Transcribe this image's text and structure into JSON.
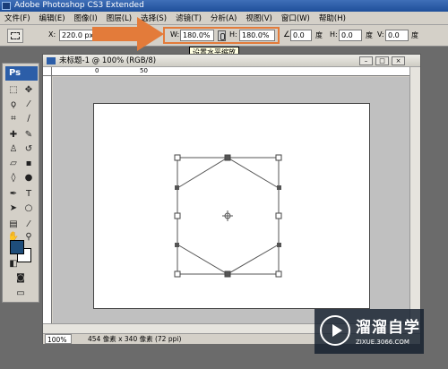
{
  "app": {
    "title": "Adobe Photoshop CS3 Extended"
  },
  "menu": [
    "文件(F)",
    "编辑(E)",
    "图像(I)",
    "图层(L)",
    "选择(S)",
    "滤镜(T)",
    "分析(A)",
    "视图(V)",
    "窗口(W)",
    "帮助(H)"
  ],
  "options": {
    "x_label": "X:",
    "x_value": "220.0 px",
    "w_label": "W:",
    "w_value": "180.0%",
    "h_label": "H:",
    "h_value": "180.0%",
    "rot_value": "0.0",
    "rot_unit": "度",
    "hskew_label": "H:",
    "hskew_value": "0.0",
    "hskew_unit": "度",
    "vskew_label": "V:",
    "vskew_value": "0.0",
    "vskew_unit": "度",
    "tooltip": "设置水平缩放"
  },
  "toolbox": {
    "logo": "Ps"
  },
  "document": {
    "title": "未标题-1 @ 100% (RGB/8)",
    "ruler_ticks": [
      "0",
      "50"
    ],
    "zoom": "100%",
    "status": "454 像素 x 340 像素 (72 ppi)"
  },
  "watermark": {
    "name": "溜溜自学",
    "url": "ZIXUE.3066.COM"
  },
  "colors": {
    "annotation": "#e37b3a",
    "foreground": "#1e4d7a",
    "background": "#ffffff"
  }
}
